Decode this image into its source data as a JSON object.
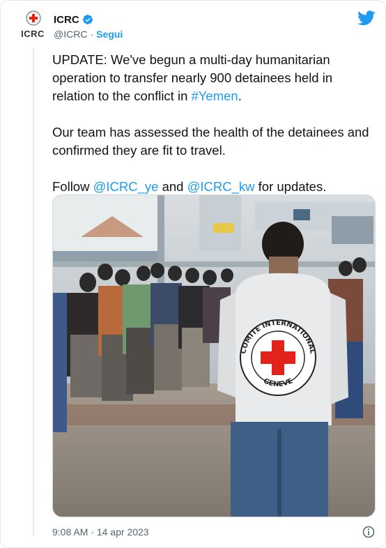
{
  "account": {
    "display_name": "ICRC",
    "handle": "@ICRC",
    "separator": "·",
    "follow_label": "Segui",
    "avatar_text": "ICRC"
  },
  "tweet": {
    "paragraph1_text": "UPDATE: We've begun a multi-day humanitarian operation to transfer nearly 900 detainees held in relation to the conflict in ",
    "paragraph1_hashtag": "#Yemen",
    "paragraph1_end": ".",
    "paragraph2": "Our team has assessed the health of the detainees and confirmed they are fit to travel.",
    "paragraph3_start": "Follow ",
    "mention1": "@ICRC_ye",
    "paragraph3_middle": " and ",
    "mention2": "@ICRC_kw",
    "paragraph3_end": " for updates."
  },
  "media": {
    "vest_text_top": "COMITE INTERNATIONAL",
    "vest_text_bottom": "GENEVE"
  },
  "footer": {
    "time": "9:08 AM",
    "date_separator": "·",
    "date": "14 apr 2023"
  },
  "colors": {
    "link": "#1d9bf0",
    "verified": "#1d9bf0",
    "red_cross": "#e2231a",
    "secondary_text": "#536471"
  },
  "icons": {
    "verified": "verified-badge-icon",
    "twitter": "twitter-bird-icon",
    "info": "info-icon"
  }
}
